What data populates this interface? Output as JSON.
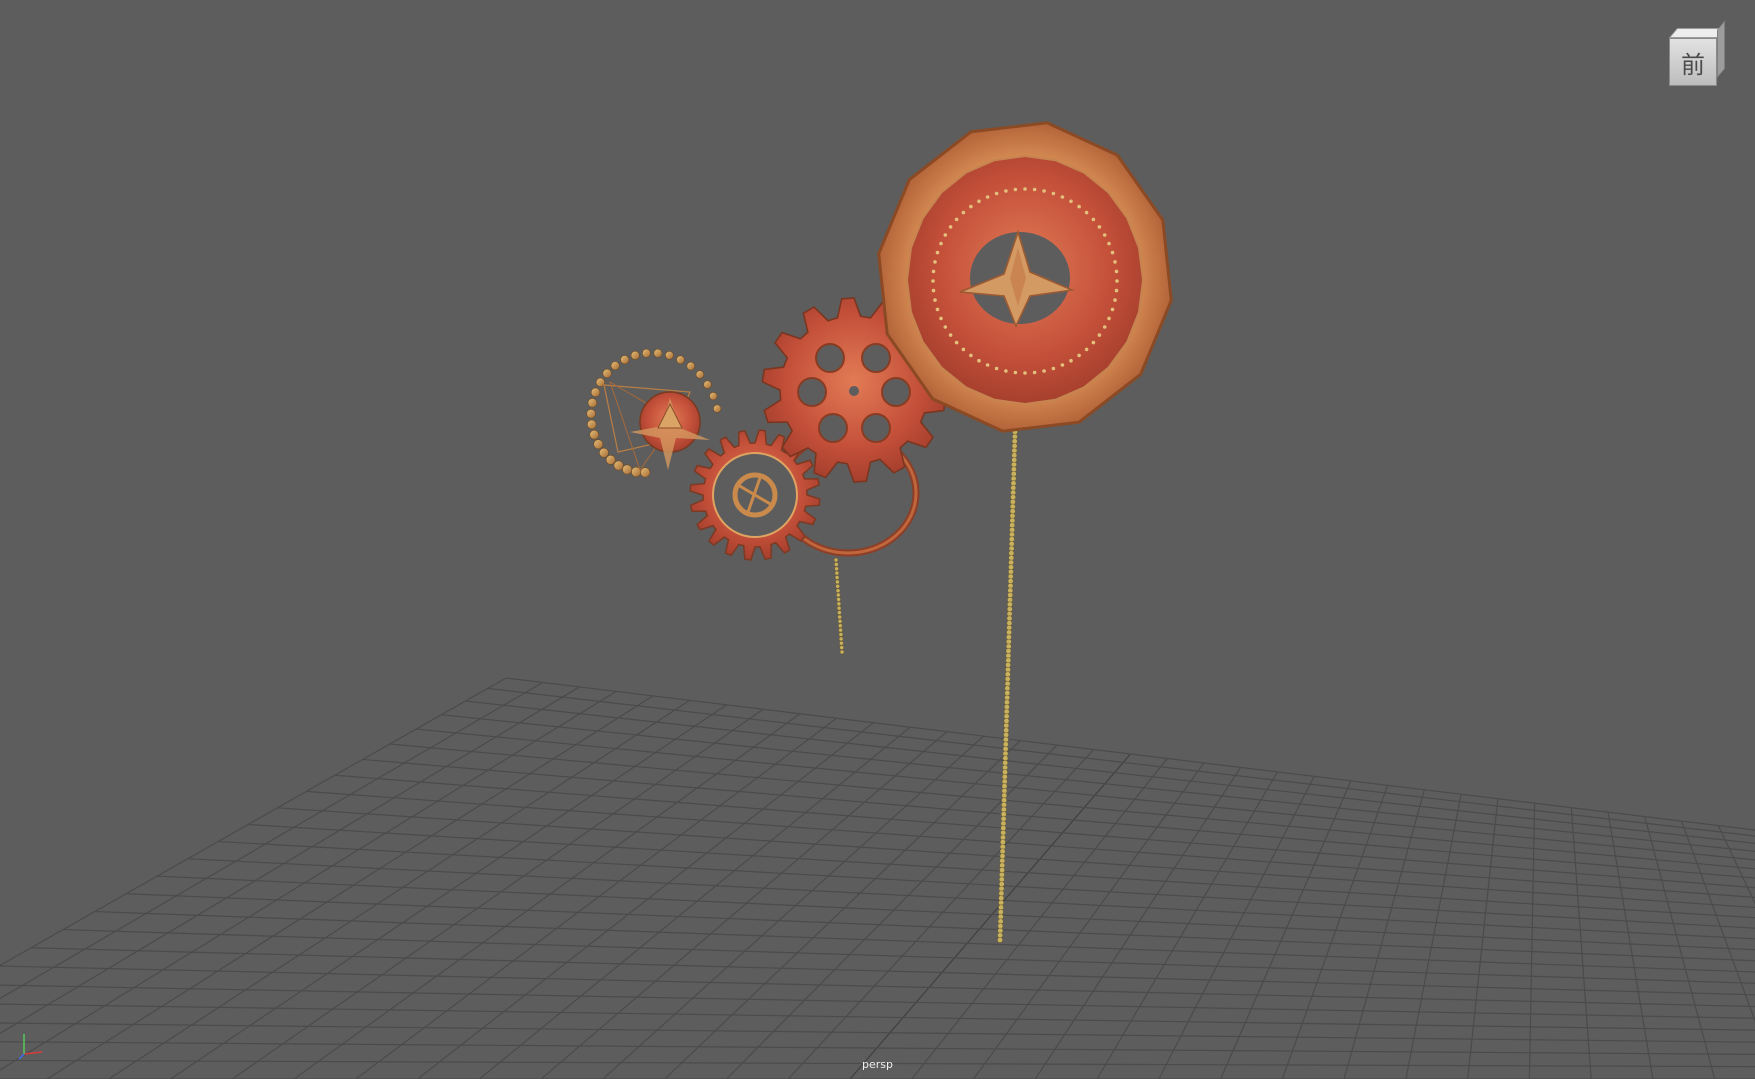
{
  "viewport": {
    "camera_label": "persp",
    "view_cube_face": "前",
    "background_color": "#5d5d5d",
    "grid_color": "#4a4a4a"
  },
  "axis_gizmo": {
    "x_color": "#d93b3b",
    "y_color": "#57c05b",
    "z_color": "#3b6fd9"
  },
  "scene_objects": [
    {
      "name": "dodecagon-clock-face",
      "color": "#c8573a"
    },
    {
      "name": "large-cog-gear",
      "color": "#c9553b"
    },
    {
      "name": "ring-gear",
      "color": "#c6653f"
    },
    {
      "name": "small-bead-spiral",
      "color": "#b48a4a"
    },
    {
      "name": "bead-chains",
      "color": "#c7b260"
    }
  ]
}
